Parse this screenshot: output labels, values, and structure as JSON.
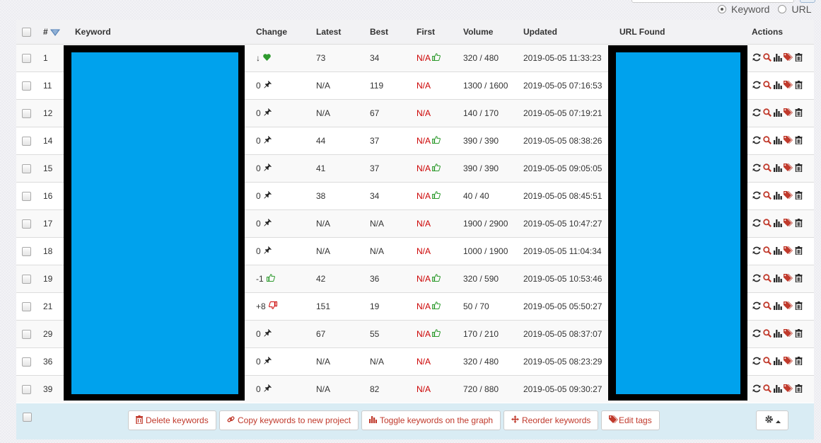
{
  "view_mode": {
    "options": [
      {
        "label": "Keyword",
        "selected": true
      },
      {
        "label": "URL",
        "selected": false
      }
    ]
  },
  "columns": {
    "num": "#",
    "keyword": "Keyword",
    "change": "Change",
    "latest": "Latest",
    "best": "Best",
    "first": "First",
    "volume": "Volume",
    "updated": "Updated",
    "url_found": "URL Found",
    "actions": "Actions"
  },
  "rows": [
    {
      "num": "1",
      "change": "↓",
      "change_icon": "heart-icon",
      "latest": "73",
      "best": "34",
      "first": "N/A",
      "first_icon": "thumbs-up-icon",
      "volume": "320 / 480",
      "updated": "2019-05-05 11:33:23"
    },
    {
      "num": "11",
      "change": "0",
      "change_icon": "pin-icon",
      "latest": "N/A",
      "best": "119",
      "first": "N/A",
      "first_icon": "",
      "volume": "1300 / 1600",
      "updated": "2019-05-05 07:16:53"
    },
    {
      "num": "12",
      "change": "0",
      "change_icon": "pin-icon",
      "latest": "N/A",
      "best": "67",
      "first": "N/A",
      "first_icon": "",
      "volume": "140 / 170",
      "updated": "2019-05-05 07:19:21"
    },
    {
      "num": "14",
      "change": "0",
      "change_icon": "pin-icon",
      "latest": "44",
      "best": "37",
      "first": "N/A",
      "first_icon": "thumbs-up-icon",
      "volume": "390 / 390",
      "updated": "2019-05-05 08:38:26"
    },
    {
      "num": "15",
      "change": "0",
      "change_icon": "pin-icon",
      "latest": "41",
      "best": "37",
      "first": "N/A",
      "first_icon": "thumbs-up-icon",
      "volume": "390 / 390",
      "updated": "2019-05-05 09:05:05"
    },
    {
      "num": "16",
      "change": "0",
      "change_icon": "pin-icon",
      "latest": "38",
      "best": "34",
      "first": "N/A",
      "first_icon": "thumbs-up-icon",
      "volume": "40 / 40",
      "updated": "2019-05-05 08:45:51"
    },
    {
      "num": "17",
      "change": "0",
      "change_icon": "pin-icon",
      "latest": "N/A",
      "best": "N/A",
      "first": "N/A",
      "first_icon": "",
      "volume": "1900 / 2900",
      "updated": "2019-05-05 10:47:27"
    },
    {
      "num": "18",
      "change": "0",
      "change_icon": "pin-icon",
      "latest": "N/A",
      "best": "N/A",
      "first": "N/A",
      "first_icon": "",
      "volume": "1000 / 1900",
      "updated": "2019-05-05 11:04:34"
    },
    {
      "num": "19",
      "change": "-1",
      "change_icon": "thumbs-up-icon",
      "latest": "42",
      "best": "36",
      "first": "N/A",
      "first_icon": "thumbs-up-icon",
      "volume": "320 / 590",
      "updated": "2019-05-05 10:53:46"
    },
    {
      "num": "21",
      "change": "+8",
      "change_icon": "thumbs-down-icon",
      "latest": "151",
      "best": "19",
      "first": "N/A",
      "first_icon": "thumbs-up-icon",
      "volume": "50 / 70",
      "updated": "2019-05-05 05:50:27"
    },
    {
      "num": "29",
      "change": "0",
      "change_icon": "pin-icon",
      "latest": "67",
      "best": "55",
      "first": "N/A",
      "first_icon": "thumbs-up-icon",
      "volume": "170 / 210",
      "updated": "2019-05-05 08:37:07"
    },
    {
      "num": "36",
      "change": "0",
      "change_icon": "pin-icon",
      "latest": "N/A",
      "best": "N/A",
      "first": "N/A",
      "first_icon": "",
      "volume": "320 / 480",
      "updated": "2019-05-05 08:23:29"
    },
    {
      "num": "39",
      "change": "0",
      "change_icon": "pin-icon",
      "latest": "N/A",
      "best": "82",
      "first": "N/A",
      "first_icon": "",
      "volume": "720 / 880",
      "updated": "2019-05-05 09:30:27"
    }
  ],
  "row_actions": [
    "refresh-icon",
    "search-icon",
    "bar-chart-icon",
    "tag-icon",
    "trash-icon"
  ],
  "footer": {
    "delete": "Delete keywords",
    "copy": "Copy keywords to new project",
    "toggle": "Toggle keywords on the graph",
    "reorder": "Reorder keywords",
    "edit_tags": "Edit tags"
  },
  "colors": {
    "na_red": "#cc0000",
    "positive_green": "#2e9a2e",
    "action_dark": "#333333",
    "action_red": "#c0392b",
    "redaction_blue": "#00a2ed",
    "footer_bg": "#d9ecf4"
  }
}
